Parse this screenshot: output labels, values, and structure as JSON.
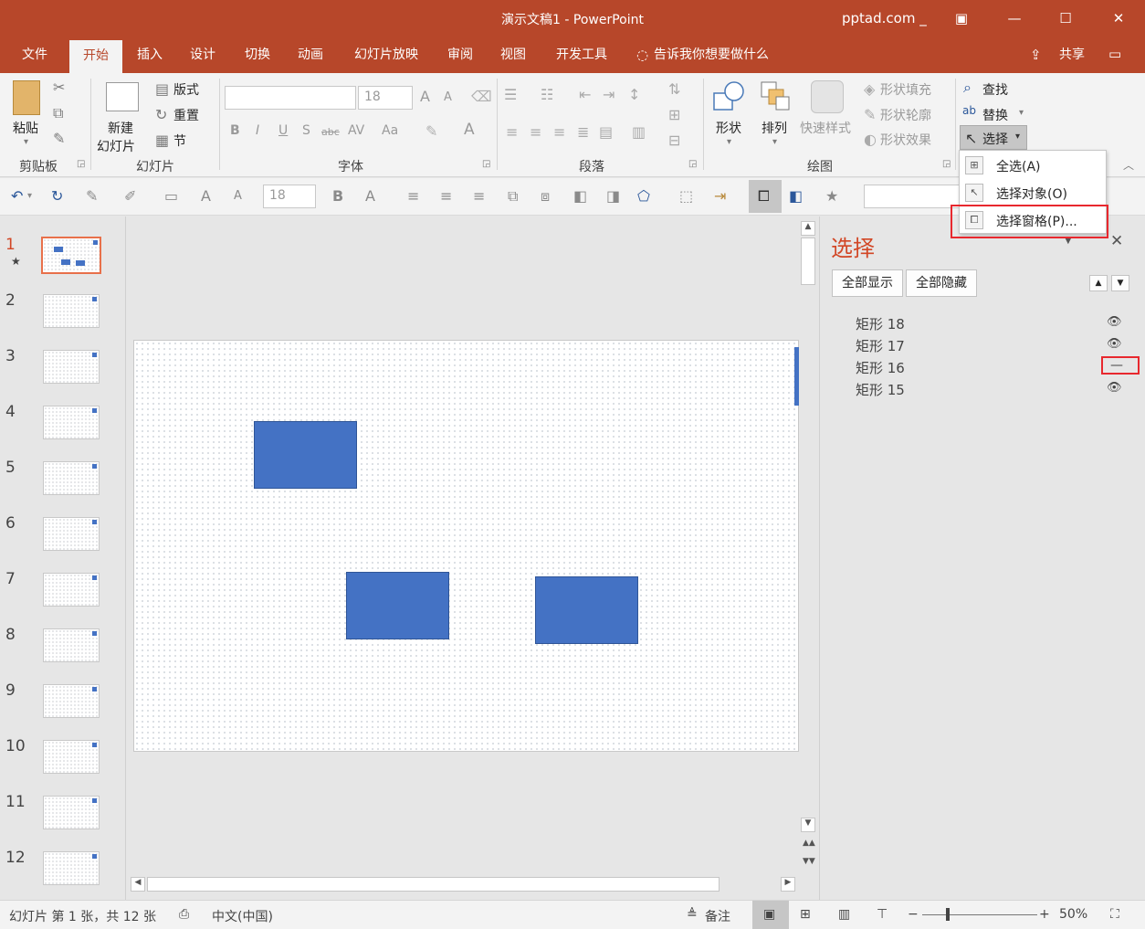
{
  "window": {
    "title": "演示文稿1  -  PowerPoint",
    "account": "pptad.com _",
    "restore_icon": "▣",
    "minimize_icon": "—",
    "maximize_icon": "☐",
    "close_icon": "✕"
  },
  "tabs": [
    "文件",
    "开始",
    "插入",
    "设计",
    "切换",
    "动画",
    "幻灯片放映",
    "审阅",
    "视图",
    "开发工具"
  ],
  "active_tab": "开始",
  "tellme": "告诉我你想要做什么",
  "share": "共享",
  "ribbon": {
    "clipboard": {
      "paste": "粘贴",
      "label": "剪贴板"
    },
    "slides": {
      "new_slide_1": "新建",
      "new_slide_2": "幻灯片",
      "layout": "版式",
      "reset": "重置",
      "section": "节",
      "label": "幻灯片"
    },
    "font": {
      "size": "18",
      "label": "字体",
      "bold": "B",
      "italic": "I",
      "underline": "U",
      "shadow": "S",
      "strike": "abc",
      "spacing": "AV",
      "case": "Aa",
      "grow": "A",
      "shrink": "A",
      "color": "A"
    },
    "paragraph": {
      "label": "段落"
    },
    "drawing": {
      "shapes": "形状",
      "arrange": "排列",
      "quick_styles": "快速样式",
      "fill": "形状填充",
      "outline": "形状轮廓",
      "effects": "形状效果",
      "label": "绘图"
    },
    "editing": {
      "find": "查找",
      "replace": "替换",
      "select": "选择"
    }
  },
  "qat": {
    "font_size": "18"
  },
  "slides": {
    "numbers": [
      "1",
      "2",
      "3",
      "4",
      "5",
      "6",
      "7",
      "8",
      "9",
      "10",
      "11",
      "12"
    ],
    "current": "1"
  },
  "select_menu": {
    "items": [
      "全选(A)",
      "选择对象(O)",
      "选择窗格(P)..."
    ]
  },
  "selection_pane": {
    "title": "选择",
    "show_all": "全部显示",
    "hide_all": "全部隐藏",
    "objects": [
      {
        "name": "矩形 18",
        "visible": true
      },
      {
        "name": "矩形 17",
        "visible": true
      },
      {
        "name": "矩形 16",
        "visible": false
      },
      {
        "name": "矩形 15",
        "visible": true
      }
    ]
  },
  "status": {
    "slide_info": "幻灯片 第 1 张，共 12 张",
    "language": "中文(中国)",
    "notes": "备注",
    "zoom": "50%"
  },
  "colors": {
    "brand": "#b7472a",
    "shape_fill": "#4472c4",
    "highlight": "#e8282e"
  }
}
